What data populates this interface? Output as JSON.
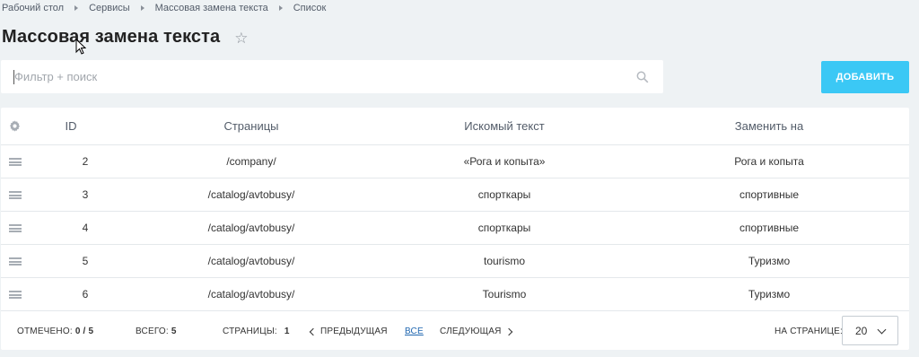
{
  "breadcrumb": [
    "Рабочий стол",
    "Сервисы",
    "Массовая замена текста",
    "Список"
  ],
  "page_title": "Массовая замена текста",
  "search": {
    "placeholder": "Фильтр + поиск",
    "value": ""
  },
  "add_button_label": "ДОБАВИТЬ",
  "columns": {
    "id": "ID",
    "pages": "Страницы",
    "find": "Искомый текст",
    "replace": "Заменить на"
  },
  "rows": [
    {
      "id": "2",
      "pages": "/company/",
      "find": "«Рога и копыта»",
      "replace": "Рога и копыта"
    },
    {
      "id": "3",
      "pages": "/catalog/avtobusy/",
      "find": "спорткары",
      "replace": "спортивные"
    },
    {
      "id": "4",
      "pages": "/catalog/avtobusy/",
      "find": "спорткары",
      "replace": "спортивные"
    },
    {
      "id": "5",
      "pages": "/catalog/avtobusy/",
      "find": "tourismo",
      "replace": "Туризмо"
    },
    {
      "id": "6",
      "pages": "/catalog/avtobusy/",
      "find": "Tourismo",
      "replace": "Туризмо"
    }
  ],
  "footer": {
    "selected_label": "ОТМЕЧЕНО:",
    "selected_value": "0 / 5",
    "total_label": "ВСЕГО:",
    "total_value": "5",
    "pages_label": "СТРАНИЦЫ:",
    "current_page": "1",
    "prev_label": "ПРЕДЫДУЩАЯ",
    "all_label": "ВСЕ",
    "next_label": "СЛЕДУЮЩАЯ",
    "per_page_label": "НА СТРАНИЦЕ:",
    "per_page_value": "20"
  },
  "colors": {
    "accent": "#3bc8f5",
    "background": "#eef2f4",
    "link": "#2067b0"
  },
  "icons": [
    "star-icon",
    "search-icon",
    "gear-icon",
    "drag-handle-icon",
    "chevron-left-icon",
    "chevron-right-icon",
    "chevron-down-icon"
  ]
}
